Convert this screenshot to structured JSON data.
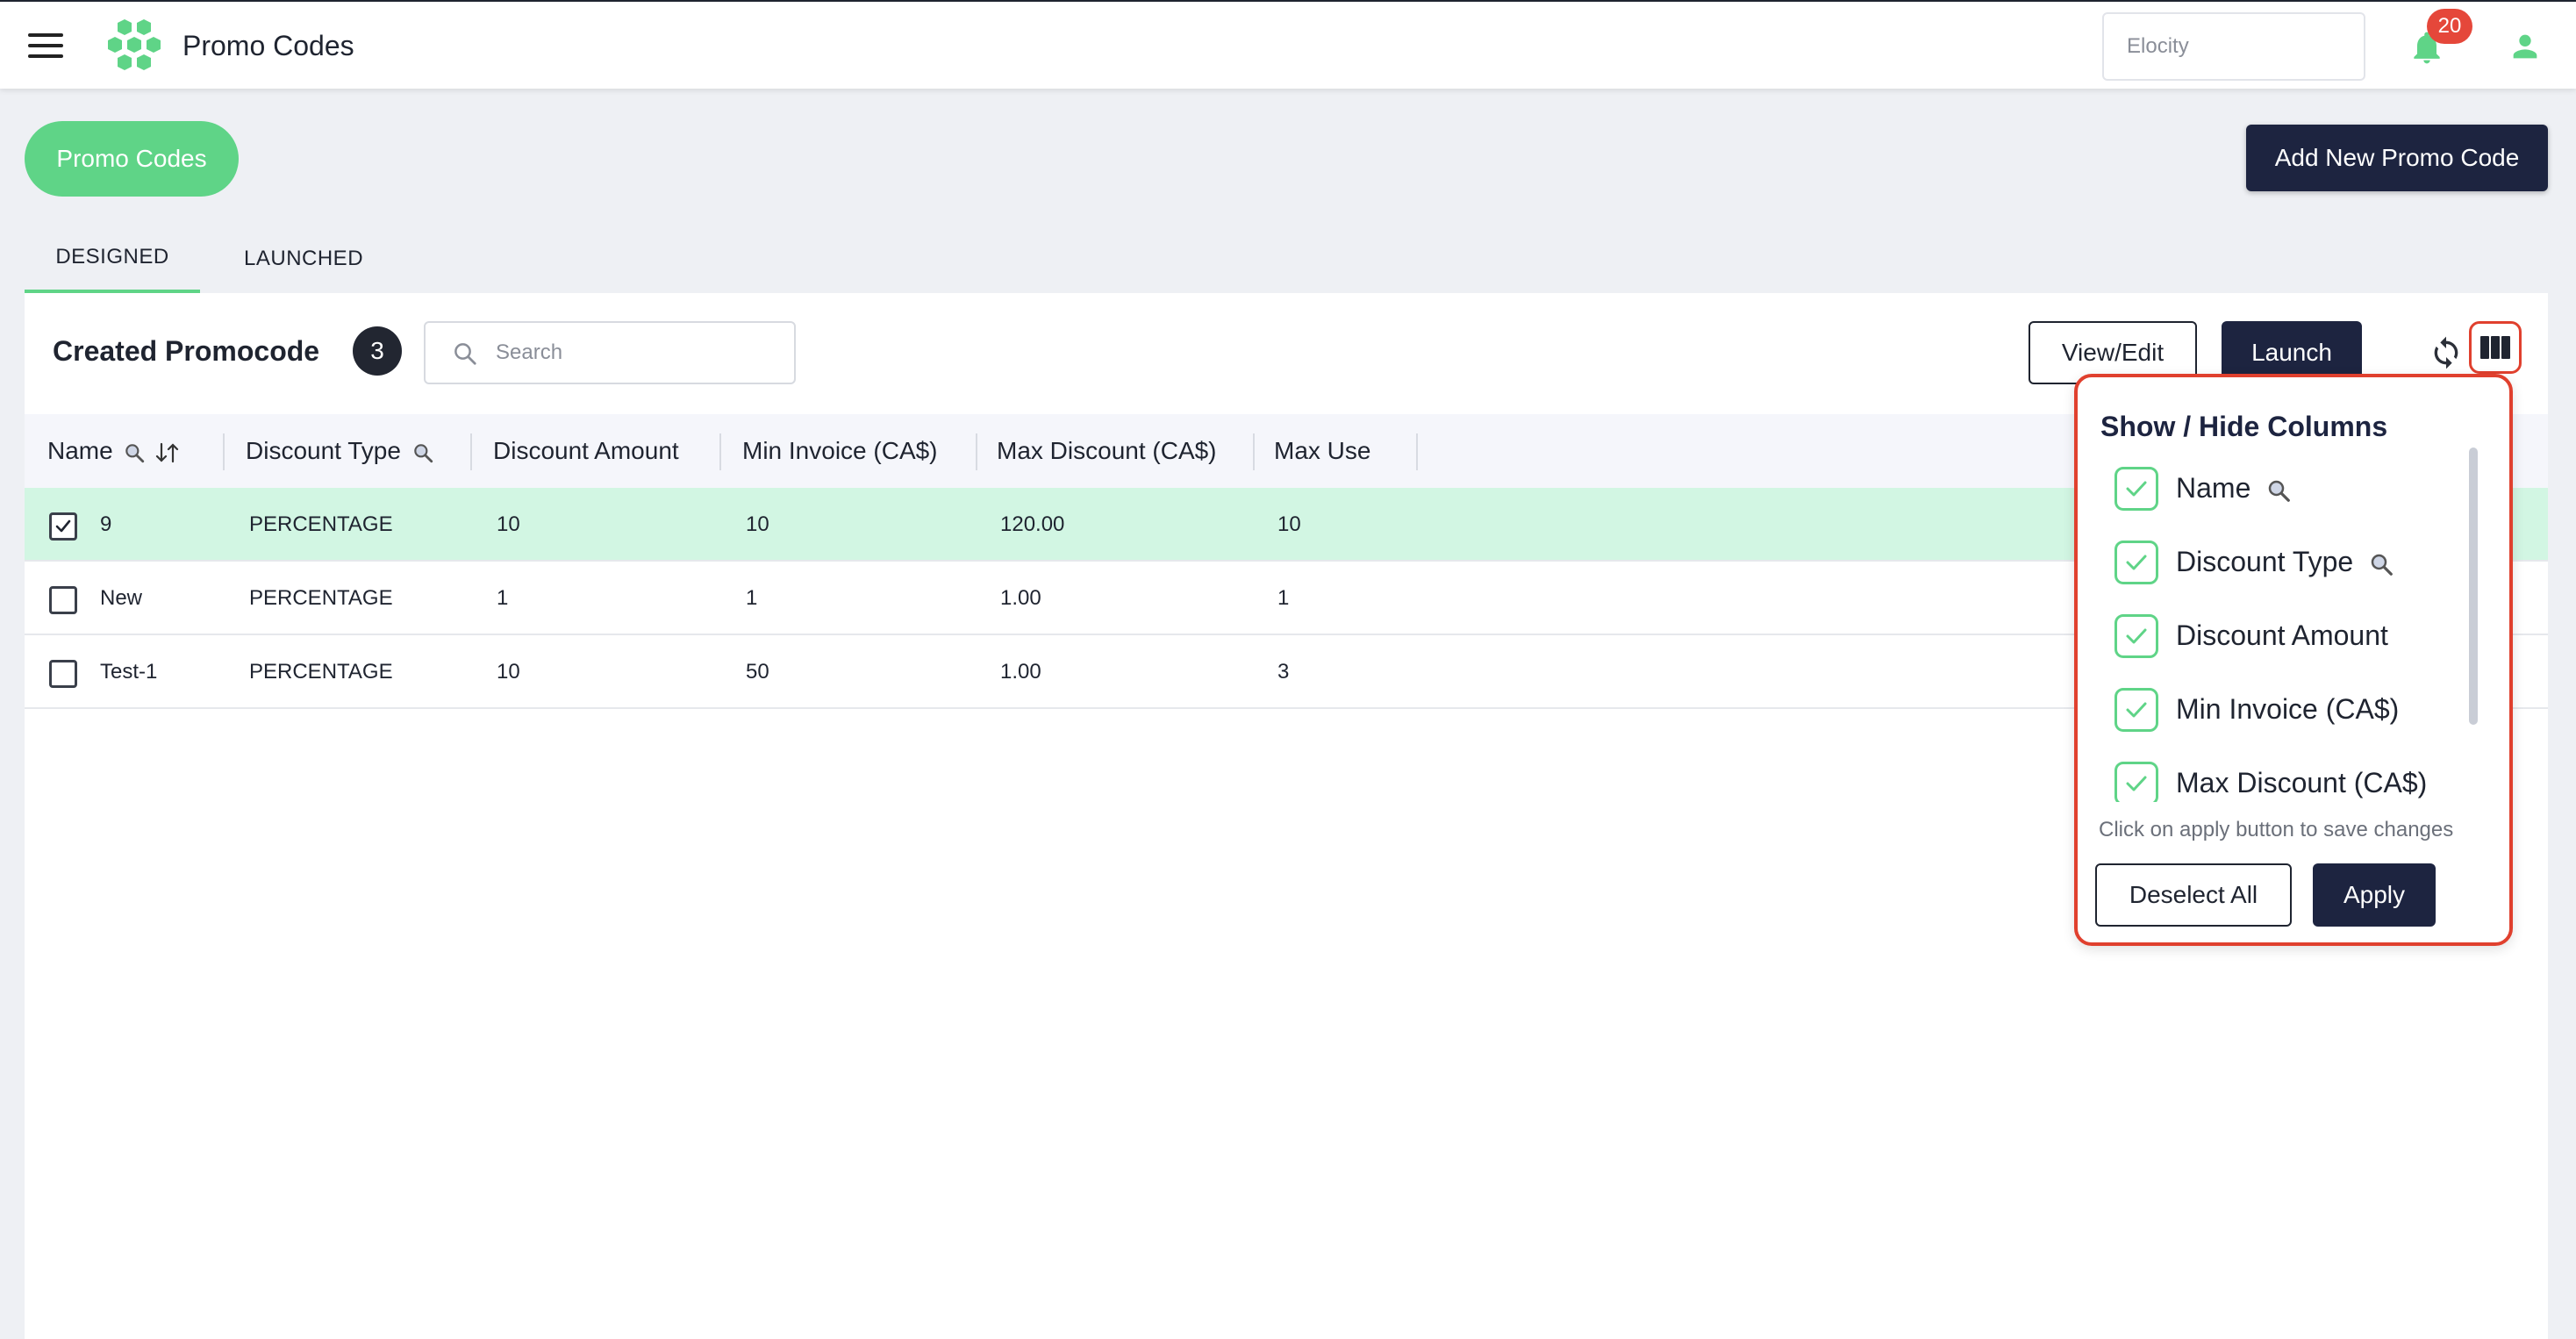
{
  "header": {
    "app_title": "Promo Codes",
    "org_placeholder": "Elocity",
    "notification_count": "20",
    "icons": [
      "menu-icon",
      "logo-icon",
      "bell-icon",
      "user-icon"
    ],
    "accent_color": "#5fd487",
    "dark_color": "#1d2440",
    "badge_color": "#e5473a"
  },
  "page": {
    "title_pill": "Promo Codes",
    "add_button": "Add New Promo Code",
    "tabs": [
      {
        "label": "DESIGNED",
        "active": true
      },
      {
        "label": "LAUNCHED",
        "active": false
      }
    ]
  },
  "card": {
    "title": "Created Promocode",
    "count": "3",
    "search_placeholder": "Search",
    "view_edit": "View/Edit",
    "launch": "Launch"
  },
  "table": {
    "columns": [
      "Name",
      "Discount Type",
      "Discount Amount",
      "Min Invoice (CA$)",
      "Max Discount (CA$)",
      "Max Use"
    ],
    "rows": [
      {
        "selected": true,
        "name": "9",
        "type": "PERCENTAGE",
        "amount": "10",
        "min_invoice": "10",
        "max_discount": "120.00",
        "max_use": "10"
      },
      {
        "selected": false,
        "name": "New",
        "type": "PERCENTAGE",
        "amount": "1",
        "min_invoice": "1",
        "max_discount": "1.00",
        "max_use": "1"
      },
      {
        "selected": false,
        "name": "Test-1",
        "type": "PERCENTAGE",
        "amount": "10",
        "min_invoice": "50",
        "max_discount": "1.00",
        "max_use": "3"
      }
    ]
  },
  "column_picker": {
    "title": "Show / Hide Columns",
    "items": [
      {
        "label": "Name",
        "checked": true,
        "searchable": true
      },
      {
        "label": "Discount Type",
        "checked": true,
        "searchable": true
      },
      {
        "label": "Discount Amount",
        "checked": true,
        "searchable": false
      },
      {
        "label": "Min Invoice (CA$)",
        "checked": true,
        "searchable": false
      },
      {
        "label": "Max Discount (CA$)",
        "checked": true,
        "searchable": false
      }
    ],
    "hint": "Click on apply button to save changes",
    "deselect_all": "Deselect All",
    "apply": "Apply"
  }
}
